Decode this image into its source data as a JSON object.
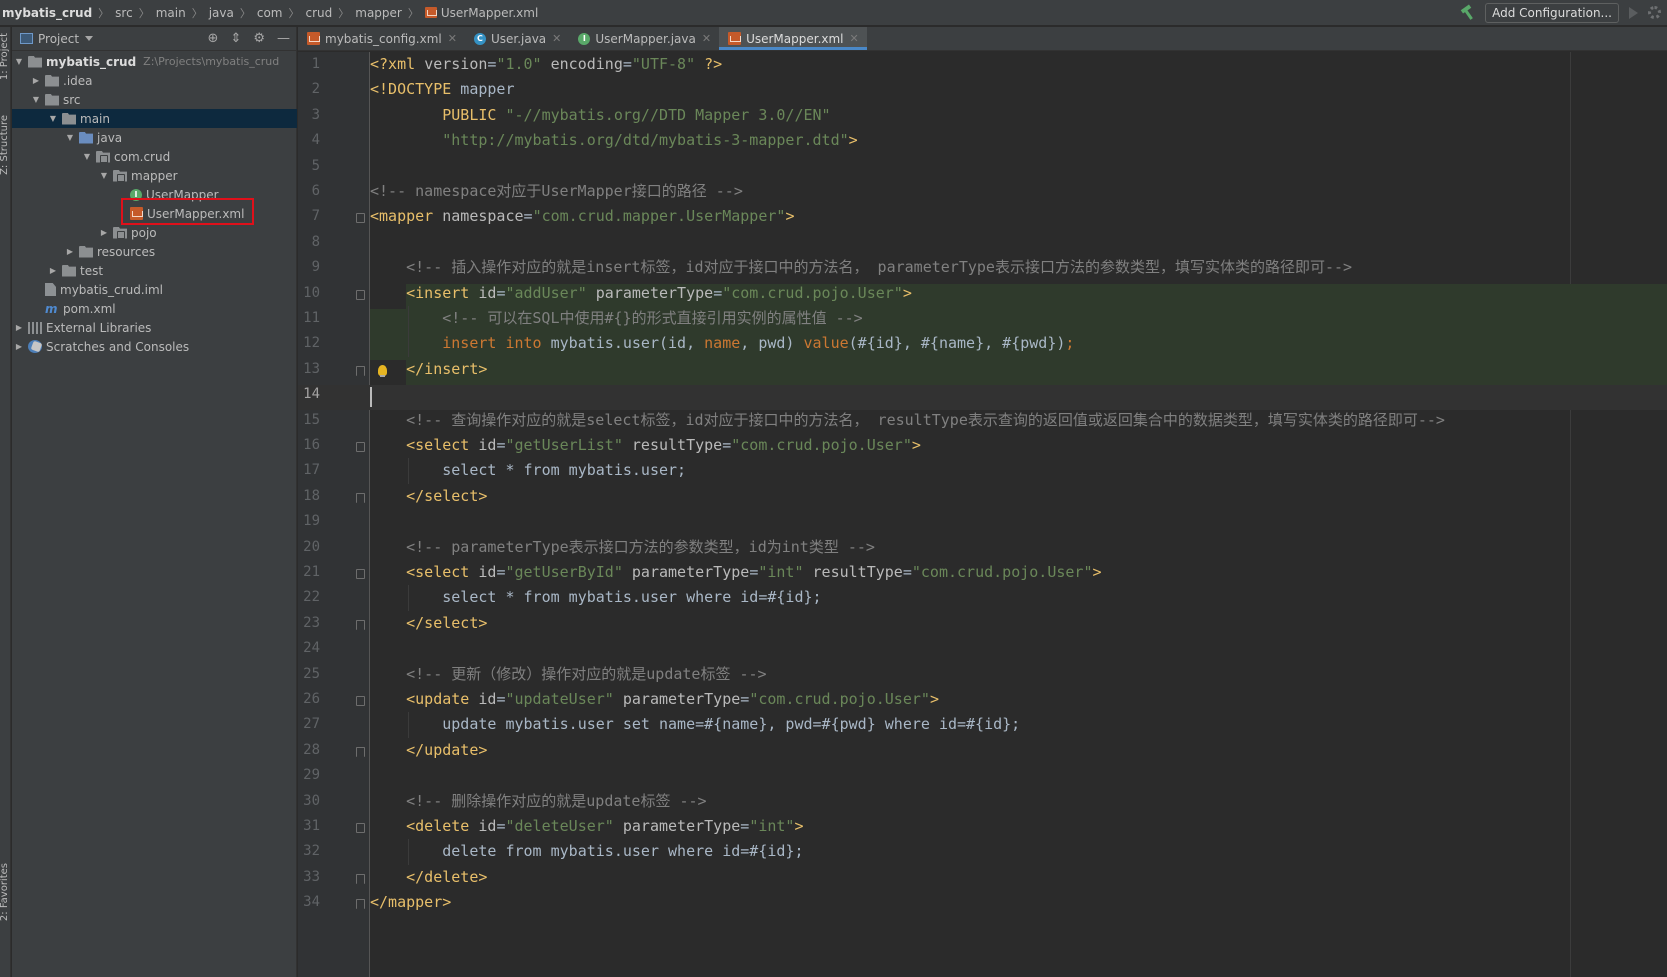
{
  "breadcrumb": {
    "items": [
      "mybatis_crud",
      "src",
      "main",
      "java",
      "com",
      "crud",
      "mapper",
      "UserMapper.xml"
    ]
  },
  "toolbar": {
    "add_config_label": "Add Configuration..."
  },
  "left_strip": {
    "project_label": "1: Project",
    "structure_label": "Z: Structure",
    "favorites_label": "2: Favorites"
  },
  "project_panel": {
    "title": "Project",
    "tree": [
      {
        "label": "mybatis_crud",
        "sub": "Z:\\Projects\\mybatis_crud"
      },
      {
        "label": ".idea"
      },
      {
        "label": "src"
      },
      {
        "label": "main"
      },
      {
        "label": "java"
      },
      {
        "label": "com.crud"
      },
      {
        "label": "mapper"
      },
      {
        "label": "UserMapper"
      },
      {
        "label": "UserMapper.xml"
      },
      {
        "label": "pojo"
      },
      {
        "label": "resources"
      },
      {
        "label": "test"
      },
      {
        "label": "mybatis_crud.iml"
      },
      {
        "label": "pom.xml"
      },
      {
        "label": "External Libraries"
      },
      {
        "label": "Scratches and Consoles"
      }
    ]
  },
  "tabs": [
    {
      "label": "mybatis_config.xml"
    },
    {
      "label": "User.java"
    },
    {
      "label": "UserMapper.java"
    },
    {
      "label": "UserMapper.xml"
    }
  ],
  "editor": {
    "line_numbers": [
      "1",
      "2",
      "3",
      "4",
      "5",
      "6",
      "7",
      "8",
      "9",
      "10",
      "11",
      "12",
      "13",
      "14",
      "15",
      "16",
      "17",
      "18",
      "19",
      "20",
      "21",
      "22",
      "23",
      "24",
      "25",
      "26",
      "27",
      "28",
      "29",
      "30",
      "31",
      "32",
      "33",
      "34"
    ],
    "current_line": "14",
    "lines": [
      "<?xml version=\"1.0\" encoding=\"UTF-8\" ?>",
      "<!DOCTYPE mapper",
      "        PUBLIC \"-//mybatis.org//DTD Mapper 3.0//EN\"",
      "        \"http://mybatis.org/dtd/mybatis-3-mapper.dtd\">",
      "",
      "<!-- namespace对应于UserMapper接口的路径 -->",
      "<mapper namespace=\"com.crud.mapper.UserMapper\">",
      "",
      "    <!-- 插入操作对应的就是insert标签，id对应于接口中的方法名， parameterType表示接口方法的参数类型，填写实体类的路径即可-->",
      "    <insert id=\"addUser\" parameterType=\"com.crud.pojo.User\">",
      "        <!-- 可以在SQL中使用#{}的形式直接引用实例的属性值 -->",
      "        insert into mybatis.user(id, name, pwd) value(#{id}, #{name}, #{pwd});",
      "    </insert>",
      "",
      "    <!-- 查询操作对应的就是select标签，id对应于接口中的方法名， resultType表示查询的返回值或返回集合中的数据类型，填写实体类的路径即可-->",
      "    <select id=\"getUserList\" resultType=\"com.crud.pojo.User\">",
      "        select * from mybatis.user;",
      "    </select>",
      "",
      "    <!-- parameterType表示接口方法的参数类型，id为int类型 -->",
      "    <select id=\"getUserById\" parameterType=\"int\" resultType=\"com.crud.pojo.User\">",
      "        select * from mybatis.user where id=#{id};",
      "    </select>",
      "",
      "    <!-- 更新（修改）操作对应的就是update标签 -->",
      "    <update id=\"updateUser\" parameterType=\"com.crud.pojo.User\">",
      "        update mybatis.user set name=#{name}, pwd=#{pwd} where id=#{id};",
      "    </update>",
      "",
      "    <!-- 删除操作对应的就是update标签 -->",
      "    <delete id=\"deleteUser\" parameterType=\"int\">",
      "        delete from mybatis.user where id=#{id};",
      "    </delete>",
      "</mapper>"
    ]
  },
  "colors": {
    "accent": "#4a88c7",
    "selection_row": "#0d293e",
    "highlight_box": "#e0101a",
    "xml_tag": "#e8bf6a",
    "xml_value": "#6a8759",
    "comment": "#808080",
    "keyword": "#cc7832"
  }
}
